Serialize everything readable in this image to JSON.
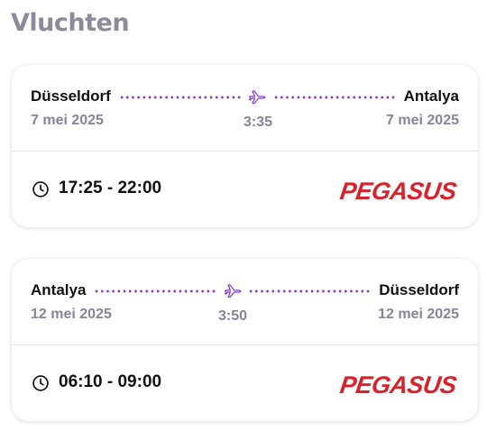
{
  "section_title": "Vluchten",
  "flights": [
    {
      "from_city": "Düsseldorf",
      "to_city": "Antalya",
      "depart_date": "7 mei 2025",
      "arrive_date": "7 mei 2025",
      "duration": "3:35",
      "time_range": "17:25 - 22:00",
      "airline": "PEGASUS"
    },
    {
      "from_city": "Antalya",
      "to_city": "Düsseldorf",
      "depart_date": "12 mei 2025",
      "arrive_date": "12 mei 2025",
      "duration": "3:50",
      "time_range": "06:10 - 09:00",
      "airline": "PEGASUS"
    }
  ],
  "colors": {
    "accent": "#8a3ad1",
    "muted_text": "#85859a",
    "airline_red": "#d9212b"
  },
  "icons": {
    "route": "airplane-icon",
    "time": "clock-icon"
  }
}
